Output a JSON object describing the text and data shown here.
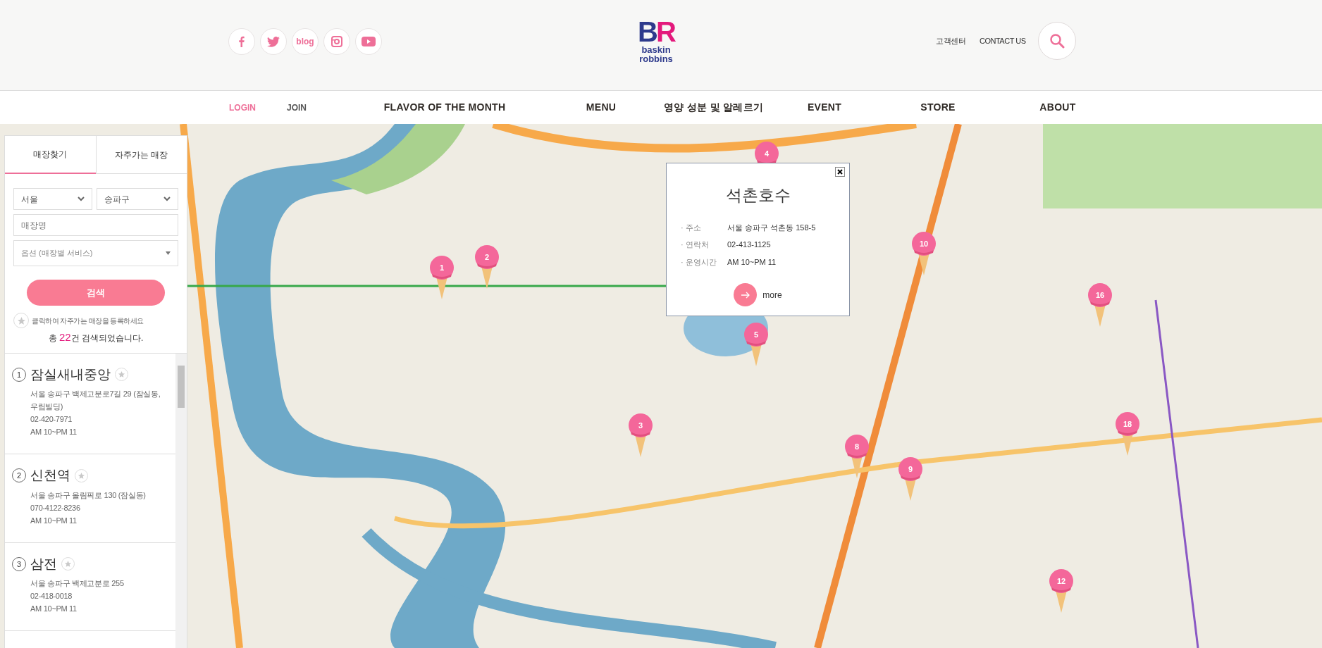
{
  "header": {
    "social_links": [
      {
        "kind": "facebook"
      },
      {
        "kind": "twitter"
      },
      {
        "kind": "blog",
        "label": "blog"
      },
      {
        "kind": "instagram"
      },
      {
        "kind": "youtube"
      }
    ],
    "logo": {
      "mark": "BR",
      "line1": "baskin",
      "line2": "robbins"
    },
    "utility_links": [
      "고객센터",
      "CONTACT US"
    ]
  },
  "nav": [
    {
      "label": "LOGIN",
      "kind": "login"
    },
    {
      "label": "JOIN",
      "kind": "join"
    },
    {
      "label": "FLAVOR OF THE MONTH",
      "kind": "main"
    },
    {
      "label": "MENU",
      "kind": "main"
    },
    {
      "label": "영양 성분 및 알레르기",
      "kind": "main"
    },
    {
      "label": "EVENT",
      "kind": "main"
    },
    {
      "label": "STORE",
      "kind": "main"
    },
    {
      "label": "ABOUT",
      "kind": "main"
    }
  ],
  "sidebar": {
    "tabs": [
      {
        "label": "매장찾기",
        "selected": true
      },
      {
        "label": "자주가는 매장",
        "selected": false
      }
    ],
    "region_select": "서울",
    "district_select": "송파구",
    "store_name": {
      "placeholder": "매장명"
    },
    "option_select": {
      "placeholder": "옵션 (매장별 서비스)"
    },
    "search_button": "검색",
    "favorite_hint": "클릭하여 자주가는 매장을 등록하세요",
    "result_prefix": "총",
    "result_count": "22",
    "result_suffix": "건 검색되었습니다.",
    "stores": [
      {
        "number": "1",
        "name": "잠실새내중앙",
        "favorite": false,
        "address": "서울 송파구 백제고분로7길 29 (잠실동, 우림빌딩)",
        "phone": "02-420-7971",
        "hours": "AM 10~PM 11"
      },
      {
        "number": "2",
        "name": "신천역",
        "favorite": false,
        "address": "서울 송파구 올림픽로 130 (잠실동)",
        "phone": "070-4122-8236",
        "hours": "AM 10~PM 11"
      },
      {
        "number": "3",
        "name": "삼전",
        "favorite": false,
        "address": "서울 송파구 백제고분로 255",
        "phone": "02-418-0018",
        "hours": "AM 10~PM 11"
      }
    ]
  },
  "popup": {
    "title": "석촌호수",
    "fields": [
      {
        "label": "· 주소",
        "value": "서울 송파구 석촌동 158-5"
      },
      {
        "label": "· 연락처",
        "value": "02-413-1125"
      },
      {
        "label": "· 운영시간",
        "value": "AM 10~PM 11"
      }
    ],
    "more": "more"
  },
  "markers": [
    {
      "label": "4"
    },
    {
      "label": "1"
    },
    {
      "label": "2"
    },
    {
      "label": "10"
    },
    {
      "label": "16"
    },
    {
      "label": "5"
    },
    {
      "label": "3"
    },
    {
      "label": "18"
    },
    {
      "label": "8"
    },
    {
      "label": "9"
    },
    {
      "label": "12"
    }
  ]
}
